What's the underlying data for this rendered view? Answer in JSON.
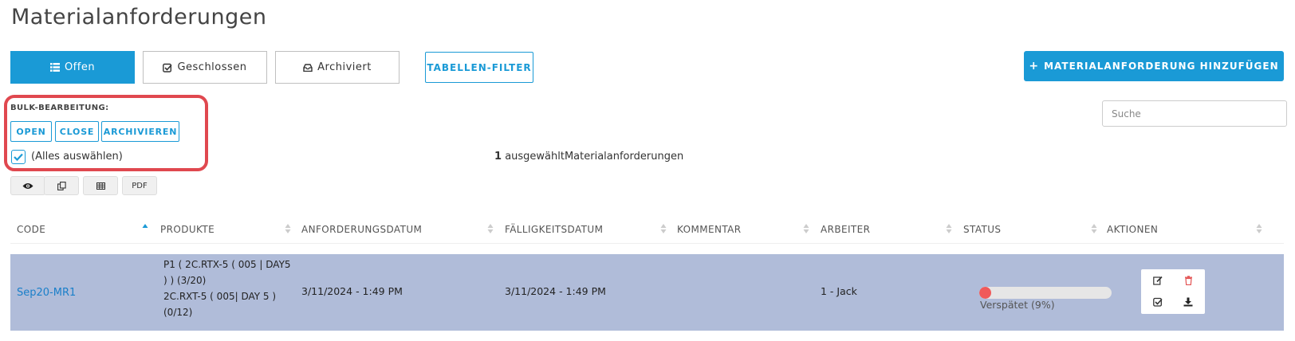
{
  "page": {
    "title": "Materialanforderungen"
  },
  "tabs": [
    {
      "label": "Offen",
      "icon": "list-icon",
      "active": true
    },
    {
      "label": "Geschlossen",
      "icon": "check-square-icon",
      "active": false
    },
    {
      "label": "Archiviert",
      "icon": "inbox-icon",
      "active": false
    }
  ],
  "table_filter_label": "TABELLEN-FILTER",
  "add_button": {
    "label": "MATERIALANFORDERUNG HINZUFÜGEN",
    "icon": "plus-icon"
  },
  "bulk": {
    "label": "BULK-BEARBEITUNG:",
    "buttons": [
      "OPEN",
      "CLOSE",
      "ARCHIVIEREN"
    ],
    "select_all_label": "(Alles auswählen)",
    "select_all_checked": true
  },
  "selection": {
    "count": "1",
    "text": "ausgewähltMaterialanforderungen"
  },
  "search": {
    "placeholder": "Suche",
    "value": ""
  },
  "export_buttons": [
    {
      "icon": "eye-icon",
      "label": ""
    },
    {
      "icon": "copy-icon",
      "label": ""
    },
    {
      "icon": "table-icon",
      "label": ""
    },
    {
      "icon": "",
      "label": "PDF"
    }
  ],
  "table": {
    "columns": [
      "CODE",
      "PRODUKTE",
      "ANFORDERUNGSDATUM",
      "FÄLLIGKEITSDATUM",
      "KOMMENTAR",
      "ARBEITER",
      "STATUS",
      "AKTIONEN"
    ],
    "rows": [
      {
        "code": "Sep20-MR1",
        "products": [
          "P1 ( 2C.RTX-5 ( 005 | DAY5",
          ") ) (3/20)",
          "2C.RXT-5 ( 005| DAY 5 )",
          "(0/12)"
        ],
        "request_date": "3/11/2024 - 1:49 PM",
        "due_date": "3/11/2024 - 1:49 PM",
        "comment": "",
        "worker": "1 - Jack",
        "status_text": "Verspätet (9%)",
        "progress_percent": 9,
        "selected": true
      }
    ]
  },
  "colors": {
    "accent": "#1a9ad6",
    "row_selected": "#b0bcd9",
    "highlight_border": "#e0484f",
    "progress": "#f05a5a",
    "link": "#1a7fc9"
  }
}
